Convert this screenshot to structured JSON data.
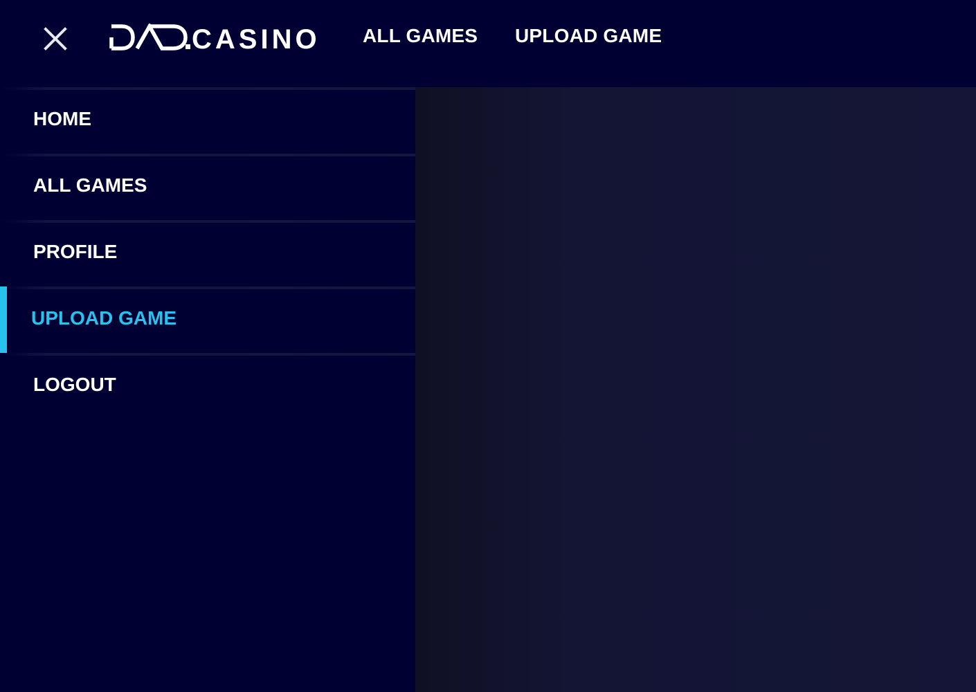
{
  "header": {
    "logo_text": "DAO.CASINO",
    "close_icon": "close-icon",
    "nav": [
      {
        "label": "ALL GAMES"
      },
      {
        "label": "UPLOAD GAME"
      }
    ]
  },
  "sidebar": {
    "items": [
      {
        "label": "HOME",
        "active": false
      },
      {
        "label": "ALL GAMES",
        "active": false
      },
      {
        "label": "PROFILE",
        "active": false
      },
      {
        "label": "UPLOAD GAME",
        "active": true
      },
      {
        "label": "LOGOUT",
        "active": false
      }
    ]
  },
  "colors": {
    "background": "#000032",
    "accent": "#27c3ee",
    "text": "#ffffff",
    "overlay": "#151637"
  }
}
